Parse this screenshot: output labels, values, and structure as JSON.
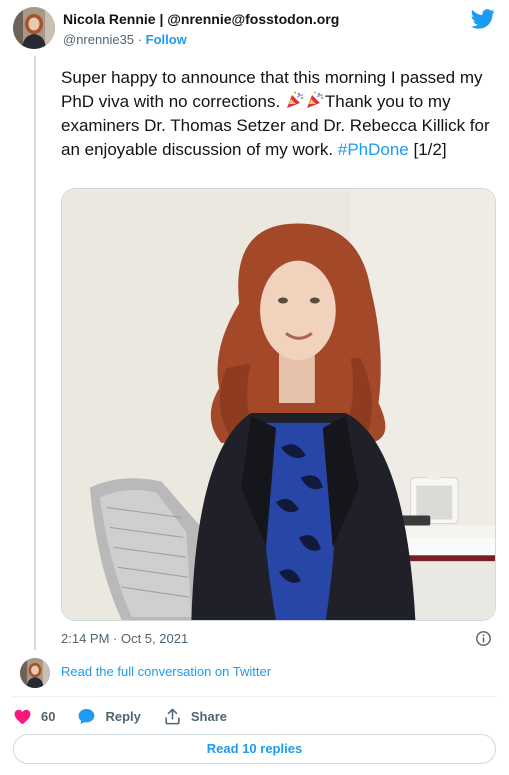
{
  "author": {
    "name": "Nicola Rennie | @nrennie@fosstodon.org",
    "handle": "@nrennie35",
    "separator": "·",
    "follow_label": "Follow"
  },
  "tweet": {
    "text_before_emoji": "Super happy to announce that this morning I passed my PhD viva with no corrections. ",
    "emoji": [
      "party-popper-icon",
      "party-popper-icon"
    ],
    "text_after_emoji": "Thank you to my examiners Dr. Thomas Setzer and Dr. Rebecca Killick for an enjoyable discussion of my work. ",
    "hashtag": "#PhDone",
    "thread_marker": " [1/2]",
    "timestamp": "2:14 PM · Oct 5, 2021"
  },
  "conversation": {
    "link_text": "Read the full conversation on Twitter"
  },
  "actions": {
    "like_count": "60",
    "reply_label": "Reply",
    "share_label": "Share"
  },
  "replies": {
    "button_label": "Read 10 replies"
  },
  "colors": {
    "accent": "#1d9bf0",
    "like": "#f91880",
    "text": "#0f1419",
    "muted": "#536471"
  }
}
